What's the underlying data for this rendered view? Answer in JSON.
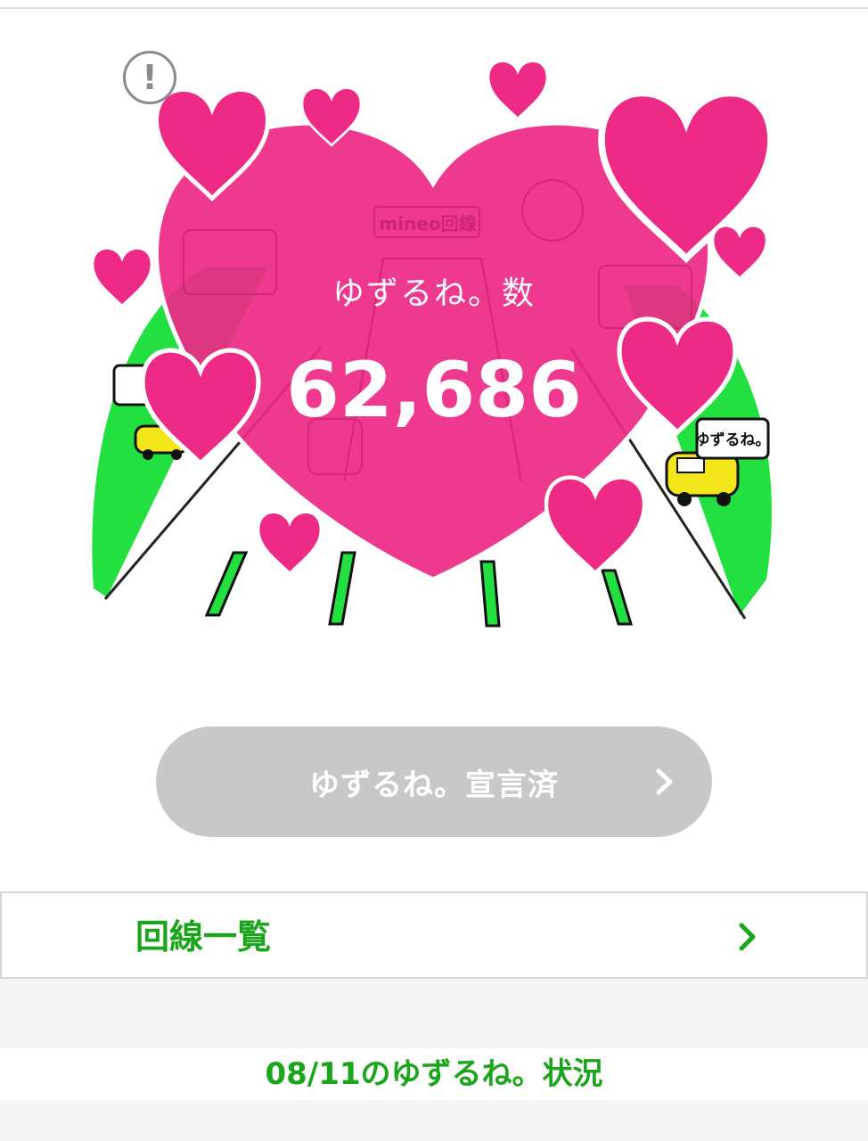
{
  "hero": {
    "counter_label": "ゆずるね。数",
    "counter_value": "62,686",
    "sign_text": "mineo回線",
    "speech_text": "ゆずるね。",
    "colors": {
      "heart": "#e8207a",
      "grass": "#22e040",
      "car": "#f2e61a"
    }
  },
  "declare_button": {
    "label": "ゆずるね。宣言済"
  },
  "line_list": {
    "label": "回線一覧"
  },
  "status": {
    "label": "08/11のゆずるね。状況"
  }
}
